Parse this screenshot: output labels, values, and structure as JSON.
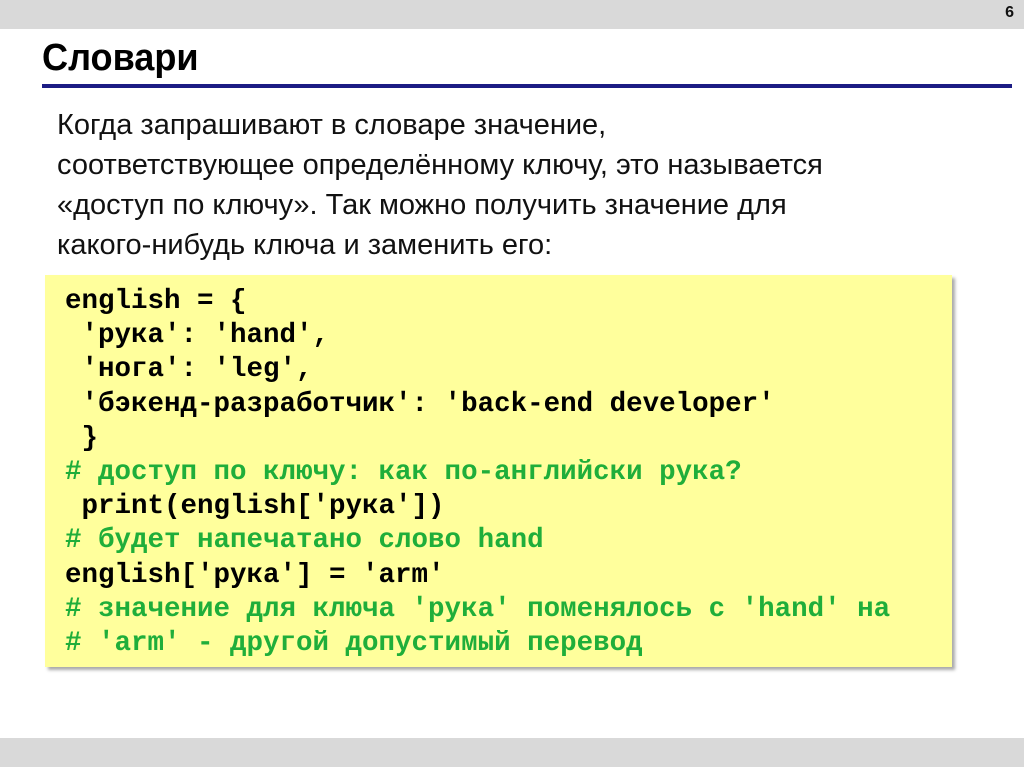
{
  "page_number": "6",
  "title": "Словари",
  "body_lines": [
    "Когда запрашивают в словаре значение,",
    "соответствующее определённому ключу, это называется",
    "«доступ по ключу». Так можно получить значение для",
    "какого-нибудь ключа и заменить его:"
  ],
  "code": [
    {
      "text": "english = {",
      "comment": false
    },
    {
      "text": " 'рука': 'hand',",
      "comment": false
    },
    {
      "text": " 'нога': 'leg',",
      "comment": false
    },
    {
      "text": " 'бэкенд-разработчик': 'back-end developer'",
      "comment": false
    },
    {
      "text": " }",
      "comment": false
    },
    {
      "text": "# доступ по ключу: как по-английски рука?",
      "comment": true
    },
    {
      "text": " print(english['рука'])",
      "comment": false
    },
    {
      "text": "# будет напечатано слово hand",
      "comment": true
    },
    {
      "text": "english['рука'] = 'arm'",
      "comment": false
    },
    {
      "text": "# значение для ключа 'рука' поменялось с 'hand' на",
      "comment": true
    },
    {
      "text": "# 'arm' - другой допустимый перевод",
      "comment": true
    }
  ],
  "colors": {
    "code_bg": "#ffff9c",
    "comment": "#1fae3a",
    "rule": "#1c1c84"
  }
}
